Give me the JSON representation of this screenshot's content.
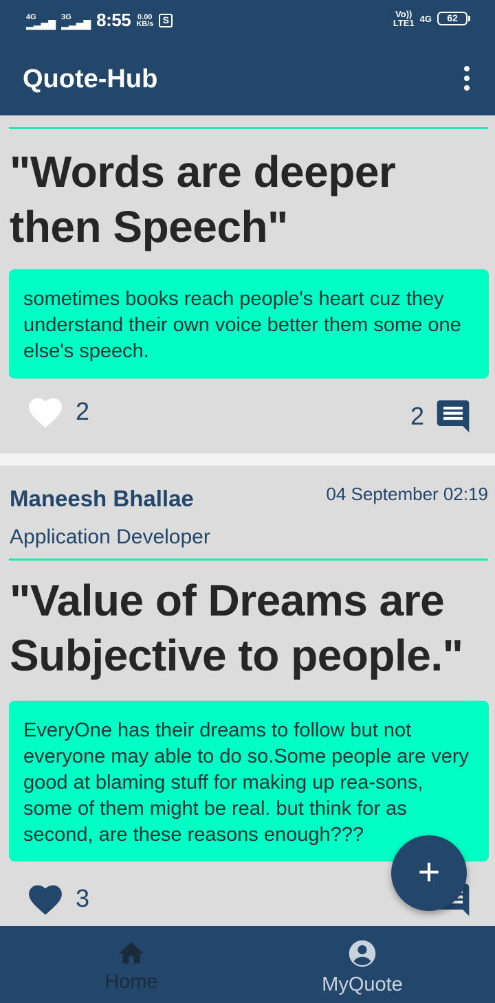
{
  "status_bar": {
    "signal1": "4G",
    "signal2": "3G",
    "time": "8:55",
    "speed_value": "0.00",
    "speed_unit": "KB/s",
    "volte": "Vo))",
    "lte": "LTE1",
    "network": "4G",
    "battery": "62"
  },
  "app_bar": {
    "title": "Quote-Hub",
    "overflow_icon": "more-vert-icon"
  },
  "posts": [
    {
      "title": "\"Words are deeper then Speech\"",
      "body": "sometimes books reach people's heart cuz they understand their own voice better them some one else's speech.",
      "likes": "2",
      "liked": false,
      "comments": "2"
    },
    {
      "author": "Maneesh Bhallae",
      "role": "Application Developer",
      "date": "04 September 02:19",
      "title": "\"Value of Dreams are Subjective to people.\"",
      "body": "EveryOne has their dreams to follow but not everyone may able to do so.Some people are very good at blaming stuff for making up rea-sons, some of them might be real. but think for as second, are these reasons enough???",
      "likes": "3",
      "liked": true
    }
  ],
  "fab": {
    "label": "+",
    "icon": "add-icon"
  },
  "bottom_nav": {
    "items": [
      {
        "label": "Home",
        "icon": "home-icon",
        "active": true
      },
      {
        "label": "MyQuote",
        "icon": "account-circle-icon",
        "active": false
      }
    ]
  },
  "colors": {
    "primary": "#22476b",
    "accent": "#1de9b6",
    "quote_bg": "#00ffc4",
    "background": "#dcdcdc"
  }
}
